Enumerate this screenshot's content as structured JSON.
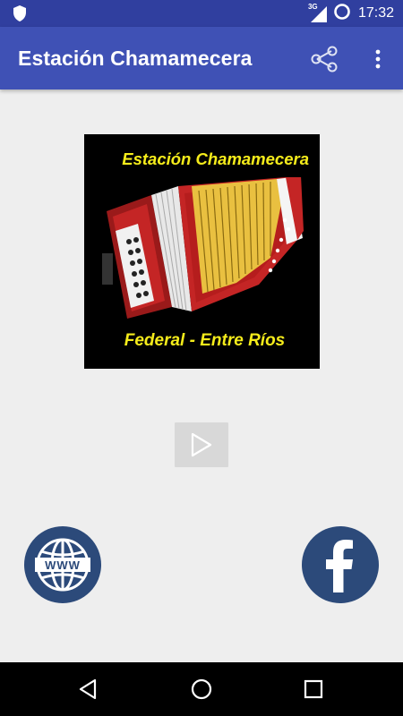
{
  "status_bar": {
    "network": "3G",
    "time": "17:32"
  },
  "app_bar": {
    "title": "Estación Chamamecera"
  },
  "logo": {
    "title": "Estación Chamamecera",
    "subtitle": "Federal - Entre Ríos"
  },
  "icons": {
    "shield": "shield-icon",
    "signal": "signal-icon",
    "battery": "circle-status-icon",
    "share": "share-icon",
    "more": "more-vert-icon",
    "play": "play-icon",
    "web": "www-globe-icon",
    "facebook": "facebook-icon",
    "back": "back-icon",
    "home": "home-icon",
    "recent": "recent-apps-icon"
  },
  "colors": {
    "status_bar": "#303f9f",
    "app_bar": "#3f51b5",
    "background": "#eeeeee",
    "logo_text": "#f5ec1b",
    "social_buttons": "#2c4a7a"
  }
}
